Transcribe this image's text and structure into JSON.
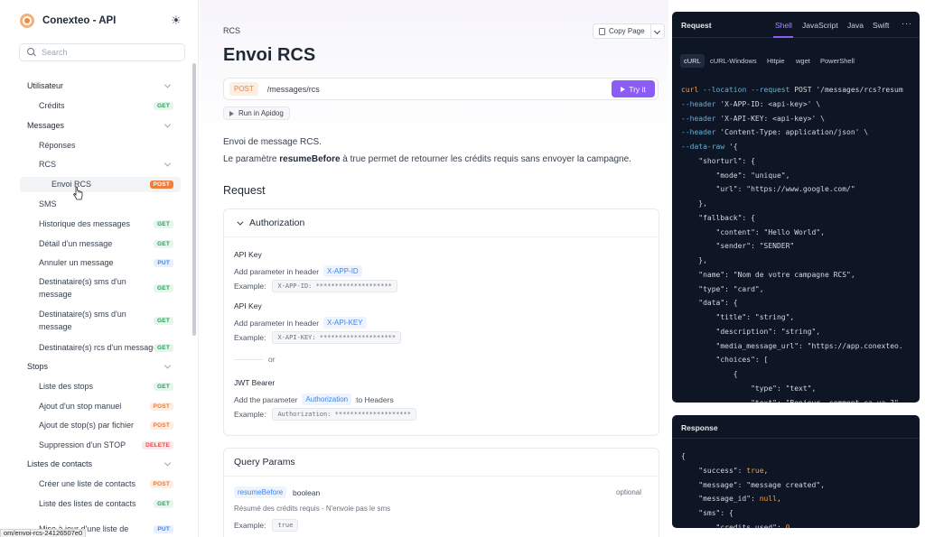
{
  "brand": {
    "title": "Conexteo - API"
  },
  "search": {
    "placeholder": "Search"
  },
  "sidebar": {
    "items": [
      {
        "label": "Utilisateur",
        "level": 0,
        "chevron": "down"
      },
      {
        "label": "Crédits",
        "level": 1,
        "method": "GET"
      },
      {
        "label": "Messages",
        "level": 0,
        "chevron": "down"
      },
      {
        "label": "Réponses",
        "level": 1,
        "chevron": "right"
      },
      {
        "label": "RCS",
        "level": 1,
        "chevron": "down"
      },
      {
        "label": "Envoi RCS",
        "level": 2,
        "method": "POST",
        "active": true
      },
      {
        "label": "SMS",
        "level": 1,
        "chevron": "right"
      },
      {
        "label": "Historique des messages",
        "level": 1,
        "method": "GET"
      },
      {
        "label": "Détail d'un message",
        "level": 1,
        "method": "GET"
      },
      {
        "label": "Annuler un message",
        "level": 1,
        "method": "PUT"
      },
      {
        "label": "Destinataire(s) sms d'un message",
        "level": 1,
        "method": "GET"
      },
      {
        "label": "Destinataire(s) sms d'un message",
        "level": 1,
        "method": "GET"
      },
      {
        "label": "Destinataire(s) rcs d'un message",
        "level": 1,
        "method": "GET"
      },
      {
        "label": "Stops",
        "level": 0,
        "chevron": "down"
      },
      {
        "label": "Liste des stops",
        "level": 1,
        "method": "GET"
      },
      {
        "label": "Ajout d'un stop manuel",
        "level": 1,
        "method": "POST"
      },
      {
        "label": "Ajout de stop(s) par fichier",
        "level": 1,
        "method": "POST"
      },
      {
        "label": "Suppression d'un STOP",
        "level": 1,
        "method": "DELETE"
      },
      {
        "label": "Listes de contacts",
        "level": 0,
        "chevron": "down"
      },
      {
        "label": "Créer une liste de contacts",
        "level": 1,
        "method": "POST"
      },
      {
        "label": "Liste des listes de contacts",
        "level": 1,
        "method": "GET"
      },
      {
        "label": "Mise à jour d'une liste de",
        "level": 1,
        "method": "PUT"
      }
    ]
  },
  "status_url": "om/envoi-rcs-24126507e0",
  "main": {
    "breadcrumb": "RCS",
    "title": "Envoi RCS",
    "copy_page": "Copy Page",
    "method": "POST",
    "path": "/messages/rcs",
    "try_it": "Try it",
    "run_apidog": "Run in Apidog",
    "desc_line1": "Envoi de message RCS.",
    "desc_line2_pre": "Le paramètre ",
    "desc_line2_bold": "resumeBefore",
    "desc_line2_post": " à true permet de retourner les crédits requis sans envoyer la campagne.",
    "request_title": "Request"
  },
  "auth": {
    "title": "Authorization",
    "api_key_1": {
      "name": "API Key",
      "add_text": "Add parameter in header",
      "param": "X-APP-ID",
      "example_label": "Example:",
      "example": "X-APP-ID: ********************"
    },
    "api_key_2": {
      "name": "API Key",
      "add_text": "Add parameter in header",
      "param": "X-API-KEY",
      "example_label": "Example:",
      "example": "X-API-KEY: ********************"
    },
    "or": "or",
    "jwt": {
      "name": "JWT Bearer",
      "add_pre": "Add the parameter",
      "param": "Authorization",
      "add_post": "to Headers",
      "example_label": "Example:",
      "example": "Authorization: ********************"
    }
  },
  "query": {
    "title": "Query Params",
    "param_name": "resumeBefore",
    "param_type": "boolean",
    "param_optional": "optional",
    "param_desc": "Résumé des crédits requis - N'envoie pas le sms",
    "example_label": "Example:",
    "example": "true"
  },
  "request_panel": {
    "title": "Request",
    "tabs": [
      "Shell",
      "JavaScript",
      "Java",
      "Swift"
    ],
    "active_tab": "Shell",
    "more": "···",
    "subtabs": [
      "cURL",
      "cURL-Windows",
      "Httpie",
      "wget",
      "PowerShell"
    ],
    "active_subtab": "cURL"
  },
  "response_panel": {
    "title": "Response"
  },
  "colors": {
    "accent": "#8b5cf6",
    "post": "#ef7d3b",
    "get": "#26a05a",
    "put": "#3b82f6",
    "delete": "#e5484d",
    "code_bg": "#0e1625"
  }
}
